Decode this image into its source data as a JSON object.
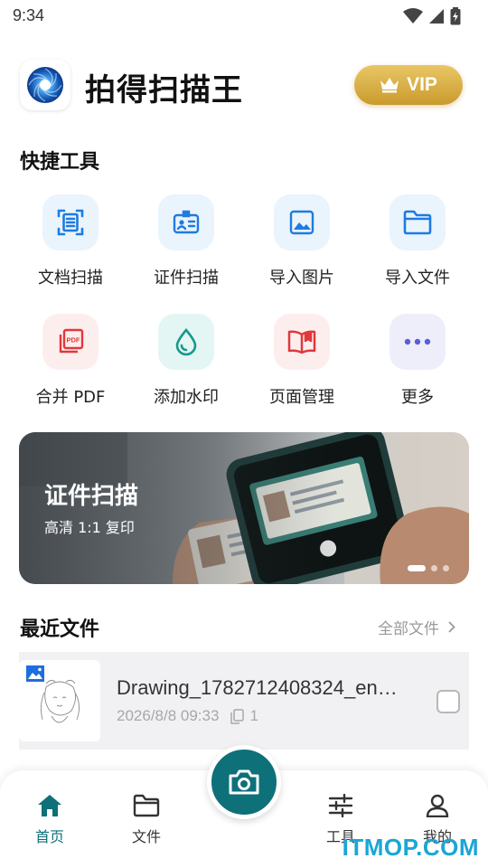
{
  "status_bar": {
    "time": "9:34"
  },
  "header": {
    "app_title": "拍得扫描王",
    "vip_label": "VIP"
  },
  "quick_tools": {
    "title": "快捷工具",
    "items": [
      {
        "label": "文档扫描",
        "icon": "document-scan-icon",
        "color": "#1e7be0",
        "bg": "#eaf4fd"
      },
      {
        "label": "证件扫描",
        "icon": "id-card-scan-icon",
        "color": "#1e7be0",
        "bg": "#eaf4fd"
      },
      {
        "label": "导入图片",
        "icon": "image-import-icon",
        "color": "#1e7be0",
        "bg": "#eaf4fd"
      },
      {
        "label": "导入文件",
        "icon": "folder-import-icon",
        "color": "#1e7be0",
        "bg": "#eaf4fd"
      },
      {
        "label": "合并 PDF",
        "icon": "pdf-merge-icon",
        "color": "#e0383c",
        "bg": "#fdeeee"
      },
      {
        "label": "添加水印",
        "icon": "water-drop-icon",
        "color": "#159a8a",
        "bg": "#e3f6f3"
      },
      {
        "label": "页面管理",
        "icon": "open-book-icon",
        "color": "#e0383c",
        "bg": "#fdeeee"
      },
      {
        "label": "更多",
        "icon": "more-dots-icon",
        "color": "#5a5fd6",
        "bg": "#eeeefb"
      }
    ]
  },
  "banner": {
    "title": "证件扫描",
    "subtitle": "高清 1:1 复印"
  },
  "recent_files": {
    "title": "最近文件",
    "all_link": "全部文件",
    "items": [
      {
        "name": "Drawing_1782712408324_en…",
        "date": "2026/8/8 09:33",
        "pages": "1"
      }
    ]
  },
  "bottom_nav": {
    "items": [
      {
        "label": "首页",
        "icon": "home-icon"
      },
      {
        "label": "文件",
        "icon": "folder-icon"
      },
      {
        "label": "工具",
        "icon": "sliders-icon"
      },
      {
        "label": "我的",
        "icon": "user-icon"
      }
    ],
    "accent": "#0e7079"
  },
  "watermark": "ITMOP.COM"
}
